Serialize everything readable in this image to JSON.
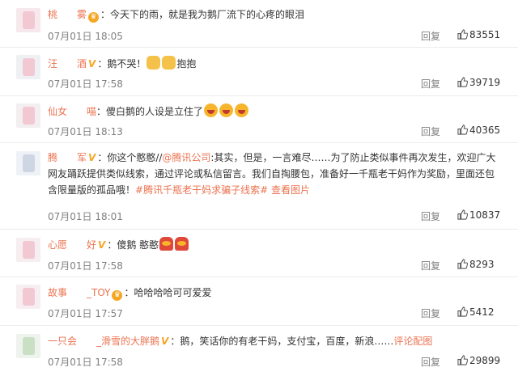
{
  "comments": [
    {
      "user": "桃　　雾",
      "badge": "vip",
      "text": "：今天下的雨，就是我为鹅厂流下的心疼的眼泪",
      "emojis": [],
      "tail": "",
      "time": "07月01日 18:05",
      "reply": "回复",
      "likes": "83551"
    },
    {
      "user": "汪　　酒",
      "badge": "v",
      "text": "：鹅不哭！",
      "emojis": [
        "dog",
        "dog"
      ],
      "tail": "抱抱",
      "time": "07月01日 17:58",
      "reply": "回复",
      "likes": "39719"
    },
    {
      "user": "仙女　　喵",
      "badge": "",
      "text": "：傻白鹅的人设是立住了",
      "emojis": [
        "laugh",
        "laugh",
        "laugh"
      ],
      "tail": "",
      "time": "07月01日 18:13",
      "reply": "回复",
      "likes": "40365"
    },
    {
      "user": "腾　　军",
      "badge": "v",
      "text_parts": [
        "：你这个憨憨//",
        "@腾讯公司",
        ":其实，但是，一言难尽……为了防止类似事件再次发生，欢迎广大网友踊跃提供类似线索，通过评论或私信留言。我们自掏腰包，准备好一千瓶老干妈作为奖励，里面还包含限量版的孤品哦！",
        "#腾讯千瓶老干妈求骗子线索#",
        " ",
        "查看图片"
      ],
      "time": "07月01日 18:01",
      "reply": "回复",
      "likes": "10837"
    },
    {
      "user": "心愿　　好",
      "badge": "v",
      "text": "：傻鹅 憨憨",
      "emojis": [
        "red",
        "red"
      ],
      "tail": "",
      "time": "07月01日 17:58",
      "reply": "回复",
      "likes": "8293"
    },
    {
      "user": "故事　　_TOY",
      "badge": "vip",
      "text": "：哈哈哈哈可可爱爱",
      "emojis": [],
      "tail": "",
      "time": "07月01日 17:57",
      "reply": "回复",
      "likes": "5412"
    },
    {
      "user": "一只会　　_滑雪的大胖鹅",
      "badge": "v",
      "text": "：鹅，笑话你的有老干妈，支付宝，百度，新浪……",
      "link": "评论配图",
      "emojis": [],
      "tail": "",
      "time": "07月01日 17:58",
      "reply": "回复",
      "likes": "29899"
    }
  ],
  "colors": {
    "accent": "#eb7350",
    "meta": "#808080",
    "divider": "#ececec"
  }
}
